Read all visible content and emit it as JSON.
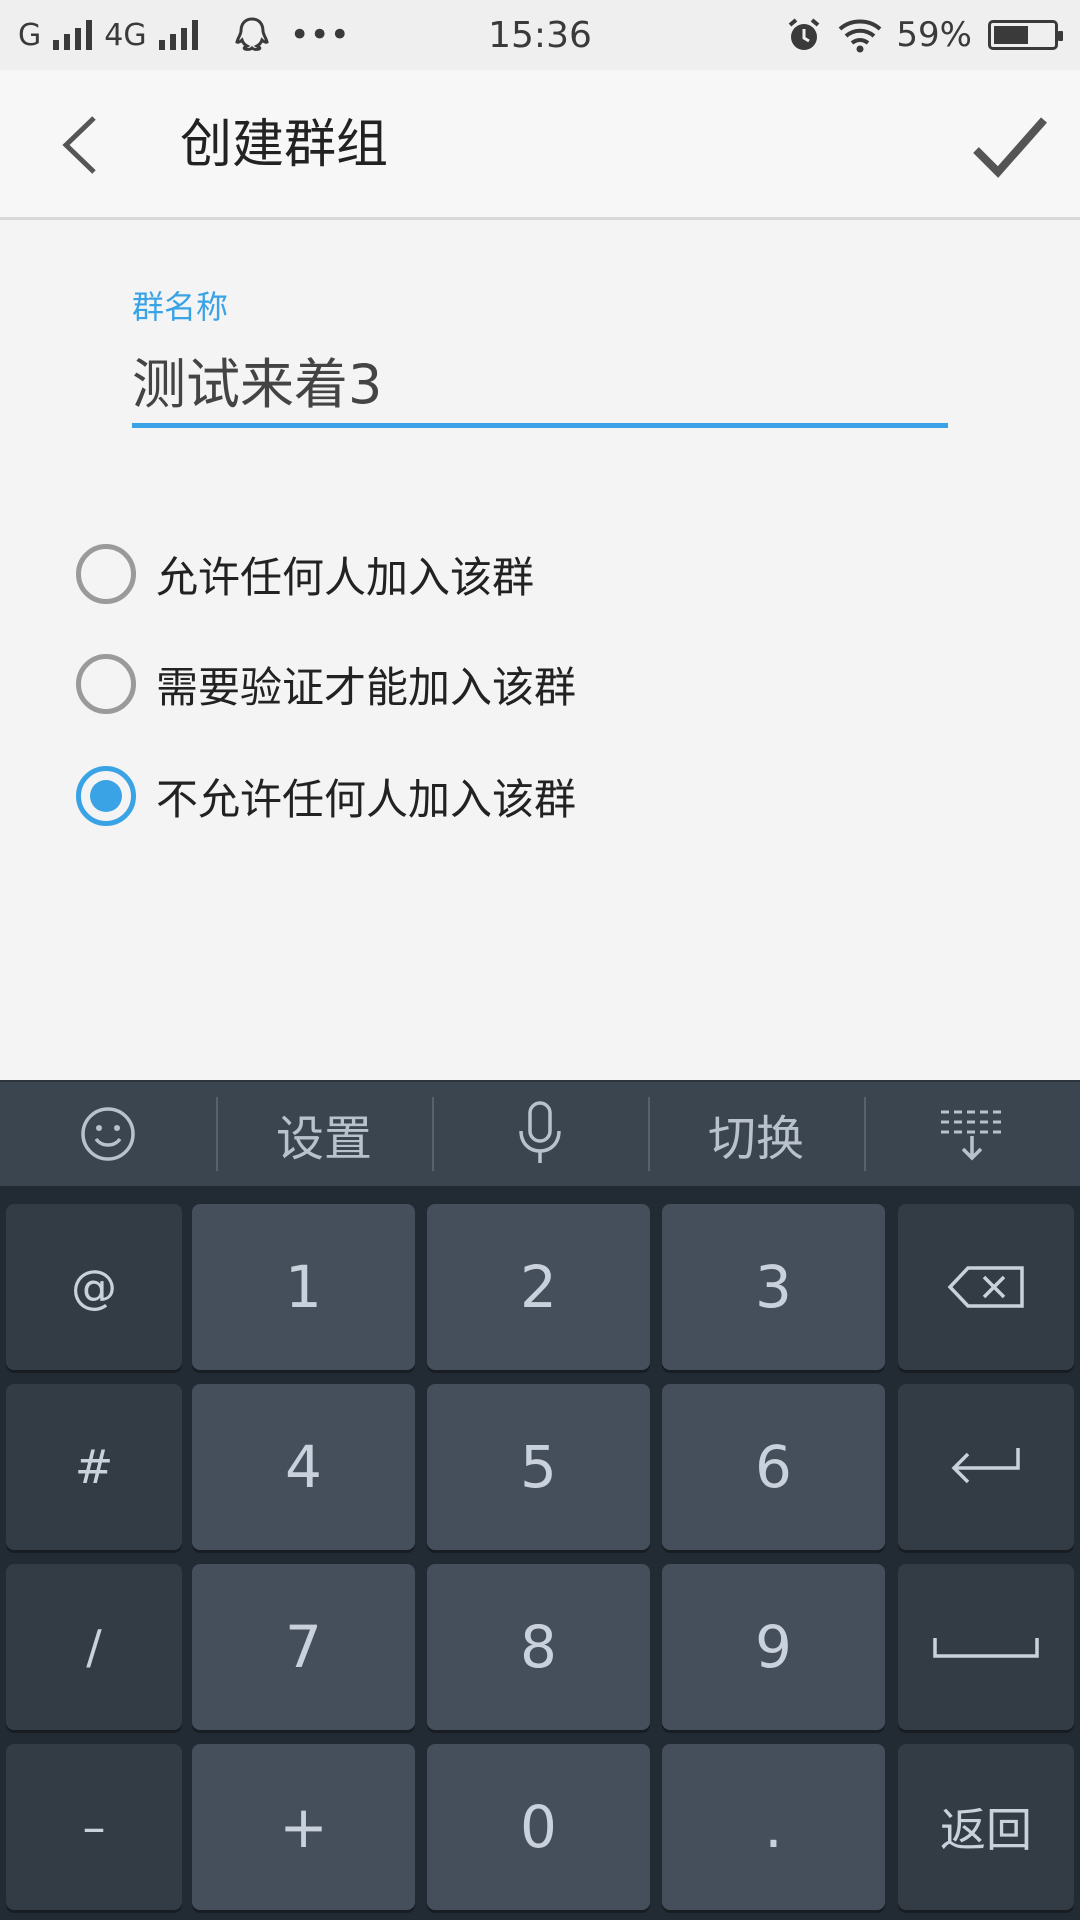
{
  "status_bar": {
    "carrier1": "G",
    "network": "4G",
    "time": "15:36",
    "battery": "59%",
    "battery_level": 0.59
  },
  "app_bar": {
    "title": "创建群组"
  },
  "form": {
    "label": "群名称",
    "value": "测试来着3",
    "accent_color": "#3aa3e6"
  },
  "options": [
    {
      "label": "允许任何人加入该群",
      "checked": false
    },
    {
      "label": "需要验证才能加入该群",
      "checked": false
    },
    {
      "label": "不允许任何人加入该群",
      "checked": true
    }
  ],
  "keyboard": {
    "toolbar": {
      "settings": "设置",
      "switch": "切换"
    },
    "rows": [
      [
        "@",
        "1",
        "2",
        "3",
        "backspace"
      ],
      [
        "#",
        "4",
        "5",
        "6",
        "enter"
      ],
      [
        "/",
        "7",
        "8",
        "9",
        "space"
      ],
      [
        "–",
        "+",
        "0",
        ".",
        "返回"
      ]
    ]
  }
}
